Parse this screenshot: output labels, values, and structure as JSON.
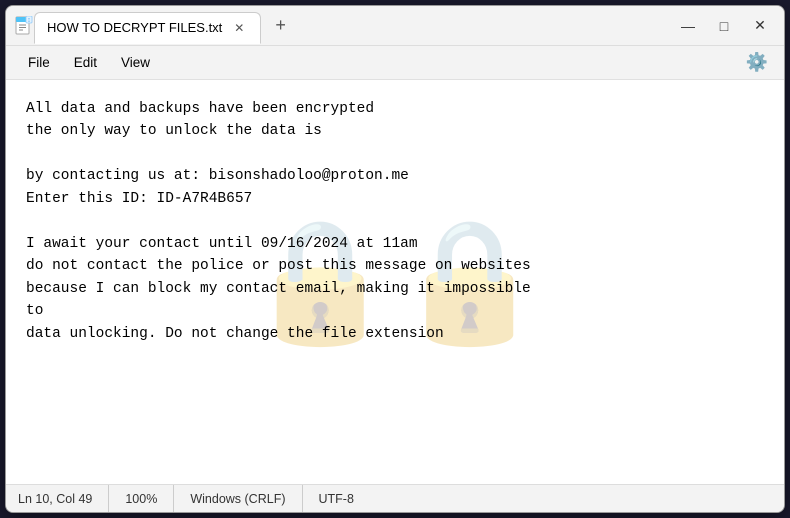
{
  "window": {
    "title": "HOW TO DECRYPT FILES.txt",
    "controls": {
      "minimize": "—",
      "maximize": "□",
      "close": "✕"
    },
    "tab_add": "+"
  },
  "menu": {
    "items": [
      "File",
      "Edit",
      "View"
    ],
    "gear_icon": "gear"
  },
  "content": {
    "watermark": "🔒🔒",
    "text": "All data and backups have been encrypted\nthe only way to unlock the data is\n\nby contacting us at: bisonshadoloo@proton.me\nEnter this ID: ID-A7R4B657\n\nI await your contact until 09/16/2024 at 11am\ndo not contact the police or post this message on websites\nbecause I can block my contact email, making it impossible\nto\ndata unlocking. Do not change the file extension"
  },
  "status_bar": {
    "position": "Ln 10, Col 49",
    "zoom": "100%",
    "line_ending": "Windows (CRLF)",
    "encoding": "UTF-8"
  }
}
